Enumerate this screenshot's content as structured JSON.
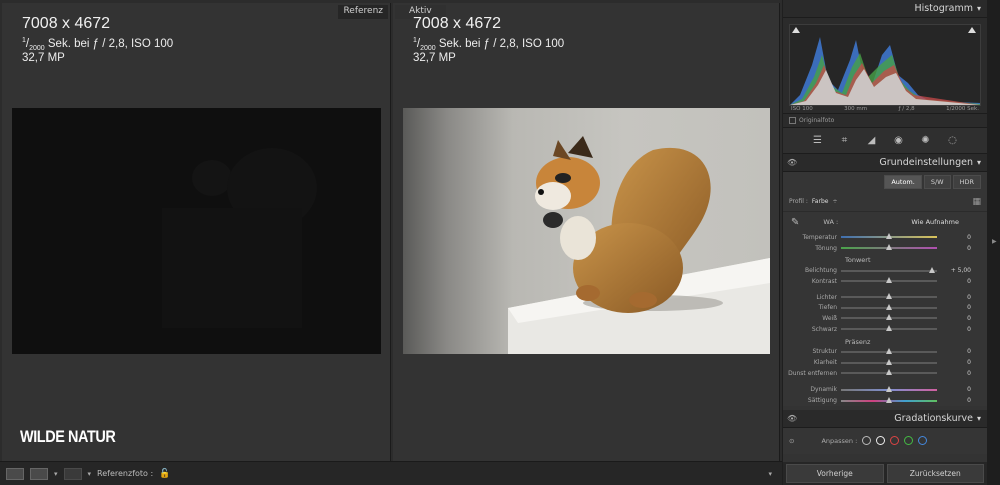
{
  "compare": {
    "reference_tag": "Referenz",
    "active_tag": "Aktiv",
    "reference": {
      "dimensions": "7008 x 4672",
      "exposure_num": "1",
      "exposure_den": "2000",
      "exposure_rest": " Sek. bei ƒ / 2,8, ISO 100",
      "megapixels": "32,7 MP"
    },
    "active": {
      "dimensions": "7008 x 4672",
      "exposure_num": "1",
      "exposure_den": "2000",
      "exposure_rest": " Sek. bei ƒ / 2,8, ISO 100",
      "megapixels": "32,7 MP"
    },
    "watermark": "WILDE NATUR"
  },
  "toolbar": {
    "reference_label": "Referenzfoto :"
  },
  "panel": {
    "histogram": {
      "title": "Histogramm",
      "iso": "ISO 100",
      "focal": "300 mm",
      "aperture": "ƒ / 2,8",
      "shutter": "1/2000 Sek.",
      "original": "Originalfoto"
    },
    "basic": {
      "title": "Grundeinstellungen",
      "modes": [
        "Autom.",
        "S/W",
        "HDR"
      ],
      "profile_label": "Profil :",
      "profile_value": "Farbe",
      "wb_label": "WA :",
      "wb_value": "Wie Aufnahme",
      "temperature": {
        "label": "Temperatur",
        "value": "0",
        "level": 0.5
      },
      "tint": {
        "label": "Tönung",
        "value": "0",
        "level": 0.5
      },
      "tone_title": "Tonwert",
      "exposure": {
        "label": "Belichtung",
        "value": "+ 5,00",
        "level": 0.95
      },
      "contrast": {
        "label": "Kontrast",
        "value": "0",
        "level": 0.5
      },
      "highlights": {
        "label": "Lichter",
        "value": "0",
        "level": 0.5
      },
      "shadows": {
        "label": "Tiefen",
        "value": "0",
        "level": 0.5
      },
      "whites": {
        "label": "Weiß",
        "value": "0",
        "level": 0.5
      },
      "blacks": {
        "label": "Schwarz",
        "value": "0",
        "level": 0.5
      },
      "presence_title": "Präsenz",
      "texture": {
        "label": "Struktur",
        "value": "0",
        "level": 0.5
      },
      "clarity": {
        "label": "Klarheit",
        "value": "0",
        "level": 0.5
      },
      "dehaze": {
        "label": "Dunst entfernen",
        "value": "0",
        "level": 0.5
      },
      "vibrance": {
        "label": "Dynamik",
        "value": "0",
        "level": 0.5
      },
      "saturation": {
        "label": "Sättigung",
        "value": "0",
        "level": 0.5
      }
    },
    "curve": {
      "title": "Gradationskurve",
      "adjust_label": "Anpassen :"
    },
    "buttons": {
      "previous": "Vorherige",
      "reset": "Zurücksetzen"
    }
  },
  "colors": {
    "panel_bg": "#333333",
    "compare_bg": "#2c2c2c",
    "accent_white": "#ffffff"
  }
}
